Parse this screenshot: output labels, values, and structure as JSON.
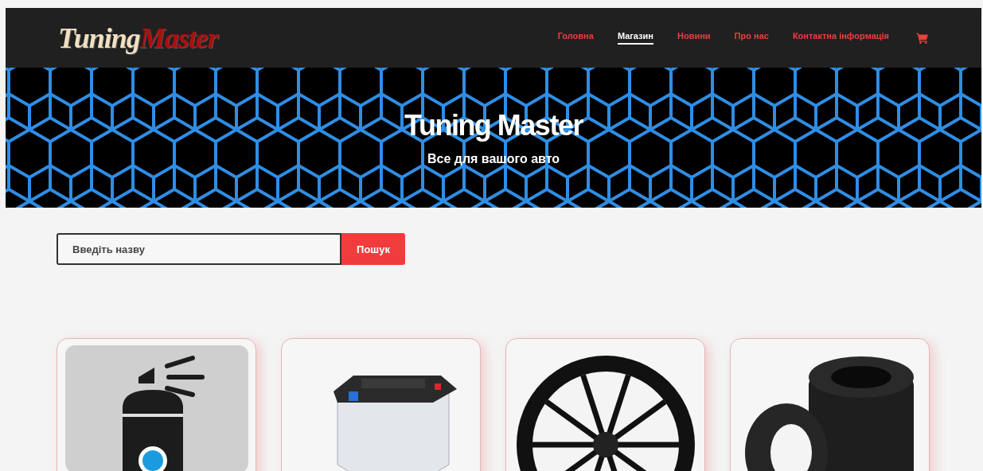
{
  "logo": {
    "part_1": "Tuning",
    "part_2": "Master"
  },
  "nav": [
    {
      "label": "Головна",
      "selected": false
    },
    {
      "label": "Магазин",
      "selected": true
    },
    {
      "label": "Новини",
      "selected": false
    },
    {
      "label": "Про нас",
      "selected": false
    },
    {
      "label": "Контактна інформація",
      "selected": false
    }
  ],
  "hero": {
    "title": "Tuning Master",
    "subtitle": "Все для вашого авто"
  },
  "search": {
    "placeholder": "Введіть назву",
    "button": "Пошук"
  },
  "products": [
    {
      "kind": "spray"
    },
    {
      "kind": "battery"
    },
    {
      "kind": "wheel"
    },
    {
      "kind": "tires"
    }
  ]
}
